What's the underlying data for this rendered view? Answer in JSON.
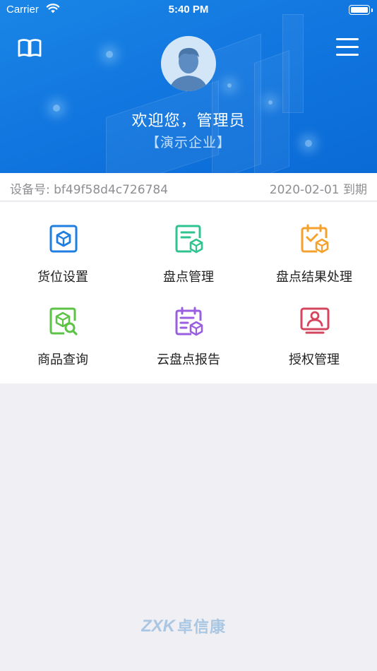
{
  "status_bar": {
    "carrier": "Carrier",
    "time": "5:40 PM"
  },
  "header": {
    "welcome": "欢迎您，管理员",
    "company": "【演示企业】",
    "left_icon": "book-icon",
    "right_icon": "menu-icon"
  },
  "device": {
    "label": "设备号:",
    "id": "bf49f58d4c726784",
    "expiry_date": "2020-02-01",
    "expiry_suffix": "到期"
  },
  "menu": [
    {
      "label": "货位设置",
      "icon": "box-location-icon",
      "color": "#1f7ee0"
    },
    {
      "label": "盘点管理",
      "icon": "inventory-doc-icon",
      "color": "#2fc38f"
    },
    {
      "label": "盘点结果处理",
      "icon": "calendar-check-icon",
      "color": "#f4a22d"
    },
    {
      "label": "商品查询",
      "icon": "product-search-icon",
      "color": "#5cc347"
    },
    {
      "label": "云盘点报告",
      "icon": "cloud-report-icon",
      "color": "#9a5fe0"
    },
    {
      "label": "授权管理",
      "icon": "user-card-icon",
      "color": "#d3465d"
    }
  ],
  "footer": {
    "logo_mark": "ZXK",
    "logo_text": "卓信康"
  }
}
